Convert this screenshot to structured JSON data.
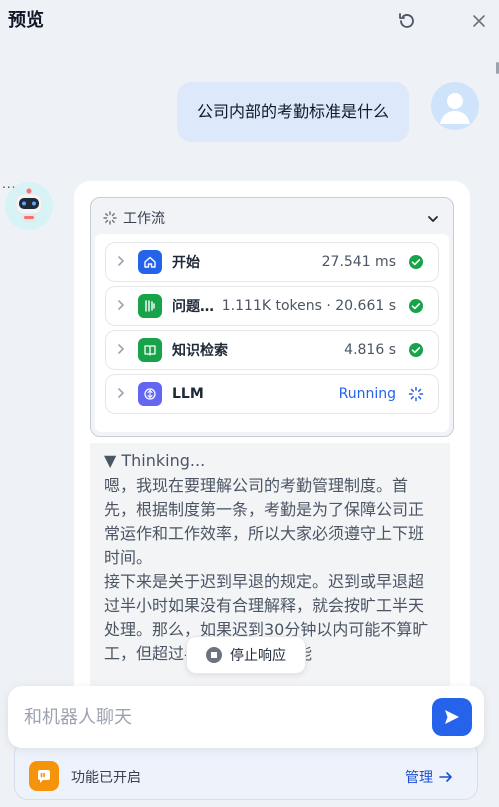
{
  "header": {
    "title": "预览"
  },
  "messages": {
    "user_text": "公司内部的考勤标准是什么",
    "bot_dots": "..."
  },
  "workflow": {
    "label": "工作流",
    "nodes": [
      {
        "name": "开始",
        "meta": "27.541 ms",
        "status": "done",
        "icon": "home-icon",
        "color": "#2563eb"
      },
      {
        "name": "问题分类器",
        "meta": "1.111K tokens · 20.661 s",
        "status": "done",
        "icon": "split-icon",
        "color": "#16a34a"
      },
      {
        "name": "知识检索",
        "meta": "4.816 s",
        "status": "done",
        "icon": "book-icon",
        "color": "#16a34a"
      },
      {
        "name": "LLM",
        "meta": "Running",
        "status": "running",
        "icon": "llm-icon",
        "color": "#6366f1"
      }
    ]
  },
  "thinking": {
    "title": "▼ Thinking...",
    "paragraph1": "嗯，我现在要理解公司的考勤管理制度。首先，根据制度第一条，考勤是为了保障公司正常运作和工作效率，所以大家必须遵守上下班时间。",
    "paragraph2": "接下来是关于迟到早退的规定。迟到或早退超过半小时如果没有合理解释，就会按旷工半天处理。那么，如果迟到30分钟以内可能不算旷工，但超过半小时的话，可能"
  },
  "stop_button": {
    "label": "停止响应"
  },
  "chat_input": {
    "placeholder": "和机器人聊天"
  },
  "footer": {
    "feature_text": "功能已开启",
    "manage_label": "管理"
  },
  "colors": {
    "accent": "#2563eb",
    "success": "#16a34a",
    "feature": "#f5930b"
  }
}
